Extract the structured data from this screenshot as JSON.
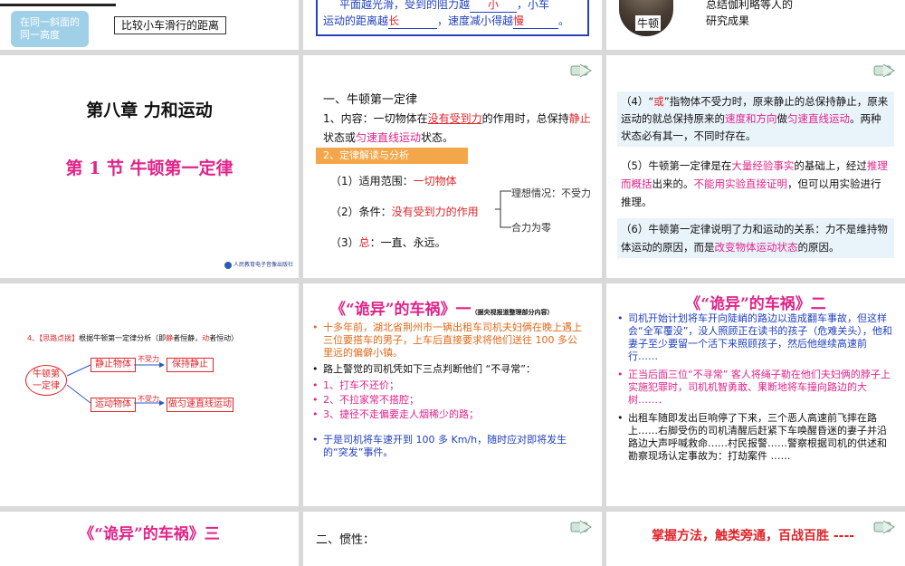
{
  "s1": {
    "bubble": "在同一斜面的同一高度",
    "box": "比较小车滑行的距离"
  },
  "s2": {
    "line1": "平面越光滑，受到的阻力越",
    "blank1": "小",
    "tail1": "，小车",
    "line2a": "运动的距离越",
    "blank2": "长",
    "line2b": "，速度减小得越",
    "blank3": "慢",
    "end": "。"
  },
  "s3": {
    "caption": "牛顿",
    "text": "总结伽利略等人的研究成果"
  },
  "s4": {
    "chapter": "第八章  力和运动",
    "section": "第 1 节   牛顿第一定律",
    "publisher": "人民教育电子音像出版社"
  },
  "s5": {
    "heading": "一、牛顿第一定律",
    "c1": "1、内容：一切物体在",
    "c2": "没有受到力",
    "c3": "的作用时，总保持",
    "c4": "静止",
    "c5": "状态或",
    "c6": "匀速直线运动",
    "c7": "状态。",
    "bar": "2、定律解读与分析",
    "i1a": "（1）适用范围：",
    "i1b": "一切物体",
    "i2a": "（2）条件：",
    "i2b": "没有受到力的作用",
    "ideal": "理想情况：不受力",
    "net": "合力为零",
    "i3a": "（3）",
    "i3b": "总",
    "i3c": "：一直、永远。"
  },
  "s6": {
    "p4a": "（4）“",
    "p4b": "或",
    "p4c": "”指物体不受力时，原来静止的总保持静止，原来运动的就总保持原来的",
    "p4d": "速度和方向",
    "p4e": "做",
    "p4f": "匀速直线运动",
    "p4g": "。两种状态必有其一，不同时存在。",
    "p5a": "（5）牛顿第一定律是在",
    "p5b": "大量经验事实",
    "p5c": "的基础上，经过",
    "p5d": "推理而概括",
    "p5e": "出来的。",
    "p5f": "不能用实验直接证明",
    "p5g": "，但可以用实验进行推理。",
    "p6a": "（6）牛顿第一定律说明了力和运动的关系：力不是维持物体运动的原因，而是",
    "p6b": "改变物体运动状态",
    "p6c": "的原因。"
  },
  "s7": {
    "title_num": "4、",
    "title_tag": "【思路点拨】",
    "title_rest": "根据牛顿第一定律分析（即",
    "still": "静",
    "t1": "者恒静，",
    "moving": "动",
    "t2": "者恒动）",
    "center": "牛顿第一定律",
    "top_obj": "静止物体",
    "top_cond": "不受力",
    "top_res": "保持静止",
    "bot_obj": "运动物体",
    "bot_cond": "不受力",
    "bot_res": "做匀速直线运动"
  },
  "s8": {
    "title": "《“诡异”的车祸》一",
    "source": "（据央视报道整理部分内容）",
    "b1": "十多年前，湖北省荆州市一辆出租车司机夫妇俩在晚上遇上三位要搭车的男子，上车后直接要求将他们送往 100 多公里远的偏僻小镇。",
    "b2": "路上警觉的司机凭如下三点判断他们 “不寻常”：",
    "b3": "1、打车不还价；",
    "b4": "2、不拉家常不搭腔；",
    "b5": "3、捷径不走偏要走人烟稀少的路；",
    "b6": "于是司机将车速开到 100 多 Km/h，随时应对即将发生的“突发”事件。"
  },
  "s9": {
    "title": "《“诡异”的车祸》二",
    "b1": "司机开始计划将车开向陡峭的路边以造成翻车事故，但这样会“全军覆没”，没人照顾正在读书的孩子（危难关头），他和妻子至少要留一个活下来照顾孩子，然后他继续高速前行……",
    "b2": "正当后面三位“不寻常” 客人将绳子勒在他们夫妇俩的脖子上实施犯罪时，司机机智勇敢、果断地将车撞向路边的大树……．",
    "b3": "出租车随即发出巨响停了下来，三个恶人高速前飞摔在路上……右脚受伤的司机清醒后赶紧下车唤醒昏迷的妻子并沿路边大声呼喊救命……村民报警……警察根据司机的供述和勘察现场认定事故为：打劫案件 ……"
  },
  "s10": {
    "title": "《“诡异”的车祸》三"
  },
  "s11": {
    "heading": "二、惯性："
  },
  "s12": {
    "title": "掌握方法，触类旁通，百战百胜 ----"
  }
}
